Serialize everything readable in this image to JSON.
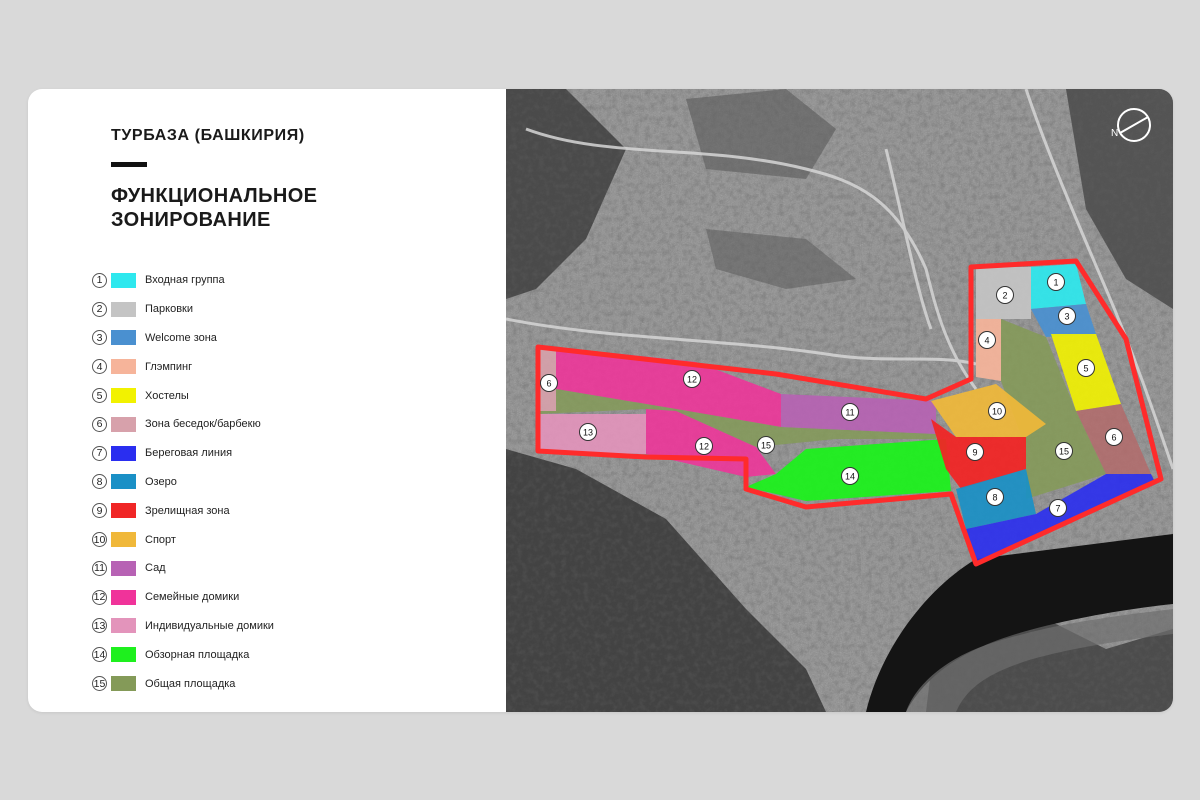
{
  "header": {
    "subtitle": "ТУРБАЗА (БАШКИРИЯ)",
    "title_line1": "ФУНКЦИОНАЛЬНОЕ",
    "title_line2": "ЗОНИРОВАНИЕ"
  },
  "legend": [
    {
      "num": "1",
      "label": "Входная группа",
      "color": "#2ee8ee"
    },
    {
      "num": "2",
      "label": "Парковки",
      "color": "#c4c4c4"
    },
    {
      "num": "3",
      "label": "Welcome зона",
      "color": "#4a90d0"
    },
    {
      "num": "4",
      "label": "Глэмпинг",
      "color": "#f6b49a"
    },
    {
      "num": "5",
      "label": "Хостелы",
      "color": "#f2f200"
    },
    {
      "num": "6",
      "label": "Зона беседок/барбекю",
      "color": "#d7a1ab"
    },
    {
      "num": "7",
      "label": "Береговая линия",
      "color": "#2a2ef0"
    },
    {
      "num": "8",
      "label": "Озеро",
      "color": "#1a90c6"
    },
    {
      "num": "9",
      "label": "Зрелищная зона",
      "color": "#f02626"
    },
    {
      "num": "10",
      "label": "Спорт",
      "color": "#f0b83a"
    },
    {
      "num": "11",
      "label": "Сад",
      "color": "#b762b4"
    },
    {
      "num": "12",
      "label": "Семейные домики",
      "color": "#f0339a"
    },
    {
      "num": "13",
      "label": "Индивидуальные домики",
      "color": "#e394bb"
    },
    {
      "num": "14",
      "label": "Обзорная площадка",
      "color": "#1ef01e"
    },
    {
      "num": "15",
      "label": "Общая площадка",
      "color": "#849a58"
    }
  ],
  "map": {
    "boundary_color": "#ff2b2b",
    "compass_label": "N",
    "zone_labels": {
      "z1": "1",
      "z2": "2",
      "z3": "3",
      "z4": "4",
      "z5": "5",
      "z6a": "6",
      "z6b": "6",
      "z7": "7",
      "z8": "8",
      "z9": "9",
      "z10": "10",
      "z11": "11",
      "z12a": "12",
      "z12b": "12",
      "z13": "13",
      "z14": "14",
      "z15a": "15",
      "z15b": "15"
    }
  }
}
